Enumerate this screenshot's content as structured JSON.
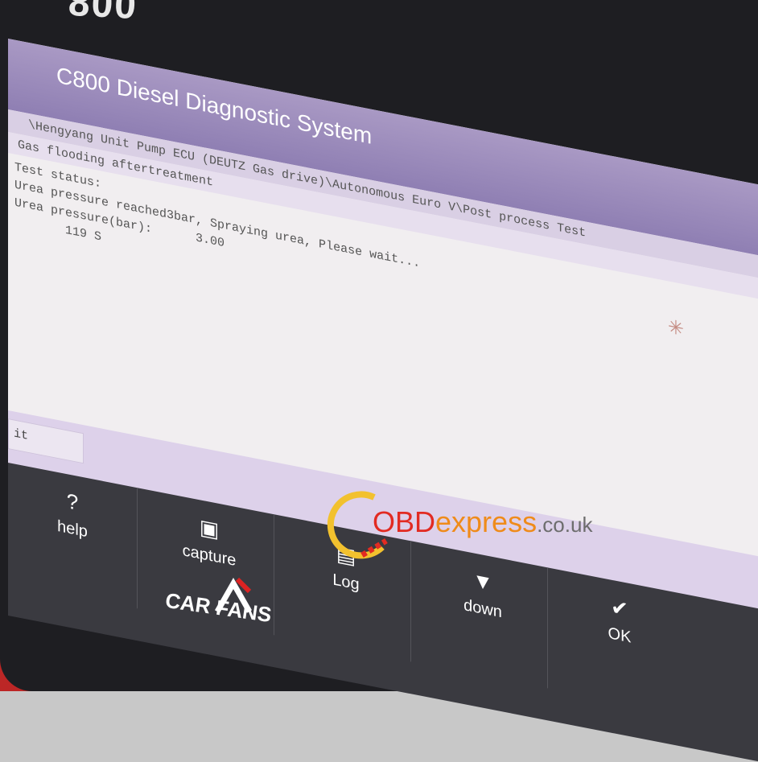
{
  "device": {
    "brand_top": "800",
    "logo_text": "CAR FANS"
  },
  "screen": {
    "title": "C800 Diesel Diagnostic System",
    "path": "\\Hengyang Unit Pump ECU (DEUTZ Gas drive)\\Autonomous Euro V\\Post process Test",
    "subtitle": "Gas flooding aftertreatment",
    "lines": [
      "Test status:",
      "Urea pressure reached3bar, Spraying urea, Please wait...",
      "Urea pressure(bar):      3.00",
      "       119 S"
    ],
    "exit_label": "it"
  },
  "softkeys": [
    {
      "label": "help",
      "icon": "question-icon"
    },
    {
      "label": "capture",
      "icon": "capture-icon"
    },
    {
      "label": "Log",
      "icon": "log-icon"
    },
    {
      "label": "down",
      "icon": "down-arrow-icon"
    },
    {
      "label": "OK",
      "icon": "check-icon"
    }
  ],
  "watermark": {
    "part1": "OBD",
    "part2": "express",
    "part3": ".co.uk"
  },
  "colors": {
    "title_bar": "#9a8abb",
    "screen_bg": "#f1eef0",
    "device_body": "#1e1e22",
    "accent_red": "#e22b22",
    "accent_orange": "#ef8b1a"
  }
}
